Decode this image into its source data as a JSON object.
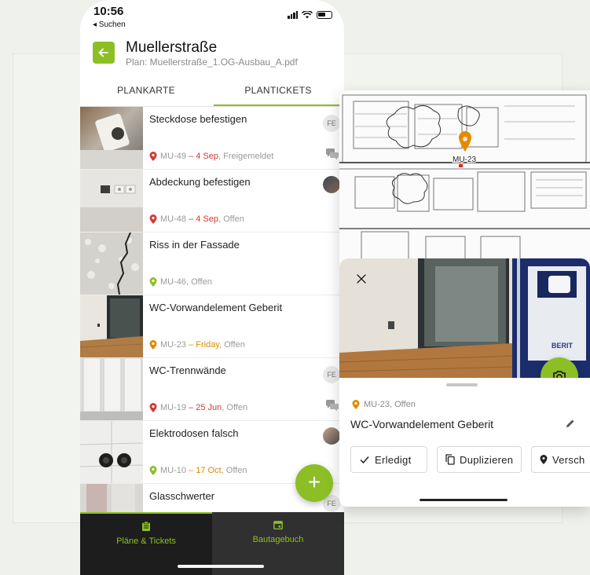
{
  "phone": {
    "status": {
      "time": "10:56",
      "back_app": "◂ Suchen"
    },
    "header": {
      "title": "Muellerstraße",
      "subtitle": "Plan: Muellerstraße_1.OG-Ausbau_A.pdf"
    },
    "tabs": [
      {
        "label": "PLANKARTE",
        "active": false
      },
      {
        "label": "PLANTICKETS",
        "active": true
      }
    ],
    "items": [
      {
        "title": "Steckdose befestigen",
        "code": "MU-49",
        "sep": " – ",
        "date": "4 Sep",
        "date_color": "red",
        "status": ", Freigemeldet",
        "pin_color": "#d33b32",
        "badge": "FE",
        "chat": true
      },
      {
        "title": "Abdeckung befestigen",
        "code": "MU-48",
        "sep": " – ",
        "date": "4 Sep",
        "date_color": "red",
        "status": ", Offen",
        "pin_color": "#d33b32",
        "avatar": true
      },
      {
        "title": "Riss in der Fassade",
        "code": "MU-46",
        "sep": "",
        "date": "",
        "date_color": "",
        "status": ", Offen",
        "pin_color": "#8cbf26"
      },
      {
        "title": "WC-Vorwandelement Geberit",
        "code": "MU-23",
        "sep": " – ",
        "date": "Friday",
        "date_color": "orange",
        "status": ", Offen",
        "pin_color": "#e08a00"
      },
      {
        "title": "WC-Trennwände",
        "code": "MU-19",
        "sep": " – ",
        "date": "25 Jun",
        "date_color": "red",
        "status": ", Offen",
        "pin_color": "#d33b32",
        "badge": "FE",
        "chat": true
      },
      {
        "title": "Elektrodosen falsch",
        "code": "MU-10",
        "sep": " – ",
        "date": "17 Oct",
        "date_color": "orange",
        "status": ", Offen",
        "pin_color": "#8cbf26",
        "avatar": true
      },
      {
        "title": "Glasschwerter",
        "badge": "FE"
      }
    ],
    "fab_label": "+",
    "bottom_nav": [
      {
        "label": "Pläne & Tickets",
        "active": true
      },
      {
        "label": "Bautagebuch",
        "active": false
      }
    ]
  },
  "detail": {
    "plan_marker": "MU-23",
    "meta": "MU-23, Offen",
    "title": "WC-Vorwandelement Geberit",
    "photo_brand": "BERIT",
    "buttons": [
      {
        "label": "Erledigt",
        "icon": "check-icon"
      },
      {
        "label": "Duplizieren",
        "icon": "copy-icon"
      },
      {
        "label": "Versch",
        "icon": "pin-icon"
      }
    ]
  },
  "colors": {
    "accent": "#8cbf26",
    "overdue": "#d33b32",
    "due_soon": "#e08a00",
    "nav_dark": "#1d1d1d"
  }
}
